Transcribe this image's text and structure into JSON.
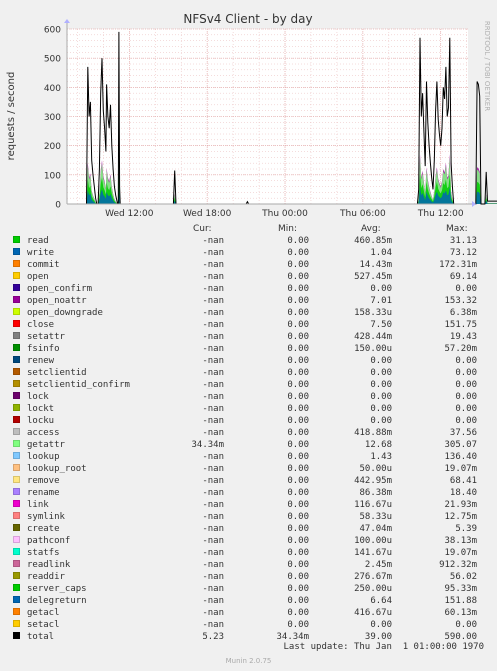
{
  "chart_data": {
    "type": "area",
    "title": "NFSv4 Client - by day",
    "ylabel": "requests / second",
    "watermark": "RRDTOOL / TOBI OETIKER",
    "ylim": [
      0,
      600
    ],
    "yticks": [
      0,
      100,
      200,
      300,
      400,
      500,
      600
    ],
    "y_tick_labels": [
      "0",
      "100",
      "200",
      "300",
      "400",
      "500",
      "600"
    ],
    "x_tick_labels": [
      "Wed 12:00",
      "Wed 18:00",
      "Thu 00:00",
      "Thu 06:00",
      "Thu 12:00"
    ],
    "x_tick_hours": [
      12,
      18,
      24,
      30,
      36
    ],
    "x_range_hours": [
      7.2,
      38.1
    ],
    "grid": true,
    "colors": {
      "background": "#f0f0f0",
      "canvas": "#ffffff",
      "grid": "#e8b8b8",
      "axis": "#aaaaaa",
      "total_line": "#000000"
    },
    "total_series": {
      "name": "total",
      "points": [
        [
          8.7,
          0
        ],
        [
          8.8,
          470
        ],
        [
          8.9,
          300
        ],
        [
          9.0,
          350
        ],
        [
          9.1,
          150
        ],
        [
          9.2,
          100
        ],
        [
          9.3,
          60
        ],
        [
          9.4,
          20
        ],
        [
          9.5,
          0
        ],
        [
          9.6,
          0
        ],
        [
          9.7,
          120
        ],
        [
          9.8,
          380
        ],
        [
          9.9,
          500
        ],
        [
          10.0,
          320
        ],
        [
          10.1,
          260
        ],
        [
          10.2,
          180
        ],
        [
          10.25,
          410
        ],
        [
          10.35,
          300
        ],
        [
          10.45,
          260
        ],
        [
          10.55,
          340
        ],
        [
          10.65,
          200
        ],
        [
          10.75,
          120
        ],
        [
          10.85,
          60
        ],
        [
          10.95,
          30
        ],
        [
          11.05,
          10
        ],
        [
          11.1,
          0
        ],
        [
          11.15,
          0
        ],
        [
          11.2,
          590
        ],
        [
          11.25,
          60
        ],
        [
          11.3,
          0
        ],
        [
          15.4,
          0
        ],
        [
          15.5,
          115
        ],
        [
          15.6,
          0
        ],
        [
          21.0,
          0
        ],
        [
          21.1,
          8
        ],
        [
          21.2,
          0
        ],
        [
          34.2,
          0
        ],
        [
          34.3,
          50
        ],
        [
          34.4,
          570
        ],
        [
          34.5,
          300
        ],
        [
          34.6,
          380
        ],
        [
          34.7,
          250
        ],
        [
          34.8,
          130
        ],
        [
          34.9,
          420
        ],
        [
          35.0,
          280
        ],
        [
          35.1,
          200
        ],
        [
          35.2,
          140
        ],
        [
          35.3,
          90
        ],
        [
          35.4,
          50
        ],
        [
          35.5,
          150
        ],
        [
          35.6,
          320
        ],
        [
          35.7,
          420
        ],
        [
          35.8,
          290
        ],
        [
          35.9,
          240
        ],
        [
          36.0,
          200
        ],
        [
          36.1,
          260
        ],
        [
          36.2,
          400
        ],
        [
          36.3,
          360
        ],
        [
          36.4,
          470
        ],
        [
          36.5,
          300
        ],
        [
          36.6,
          330
        ],
        [
          36.7,
          570
        ],
        [
          36.8,
          140
        ],
        [
          36.9,
          60
        ],
        [
          37.0,
          0
        ],
        [
          38.7,
          0
        ],
        [
          38.8,
          420
        ],
        [
          38.9,
          410
        ],
        [
          39.0,
          370
        ],
        [
          39.1,
          0
        ],
        [
          39.4,
          0
        ],
        [
          39.5,
          110
        ],
        [
          39.6,
          10
        ],
        [
          40.5,
          10
        ]
      ]
    },
    "stack_fraction": 0.3,
    "legend_header": {
      "cur": "Cur:",
      "min": "Min:",
      "avg": "Avg:",
      "max": "Max:"
    },
    "legend": [
      {
        "name": "read",
        "color": "#00cc00",
        "cur": "-nan",
        "min": "0.00",
        "avg": "460.85m",
        "max": "31.13"
      },
      {
        "name": "write",
        "color": "#0066b3",
        "cur": "-nan",
        "min": "0.00",
        "avg": "1.04",
        "max": "73.12"
      },
      {
        "name": "commit",
        "color": "#ff8000",
        "cur": "-nan",
        "min": "0.00",
        "avg": "14.43m",
        "max": "172.31m"
      },
      {
        "name": "open",
        "color": "#ffcc00",
        "cur": "-nan",
        "min": "0.00",
        "avg": "527.45m",
        "max": "69.14"
      },
      {
        "name": "open_confirm",
        "color": "#330099",
        "cur": "-nan",
        "min": "0.00",
        "avg": "0.00",
        "max": "0.00"
      },
      {
        "name": "open_noattr",
        "color": "#990099",
        "cur": "-nan",
        "min": "0.00",
        "avg": "7.01",
        "max": "153.32"
      },
      {
        "name": "open_downgrade",
        "color": "#ccff00",
        "cur": "-nan",
        "min": "0.00",
        "avg": "158.33u",
        "max": "6.38m"
      },
      {
        "name": "close",
        "color": "#ff0000",
        "cur": "-nan",
        "min": "0.00",
        "avg": "7.50",
        "max": "151.75"
      },
      {
        "name": "setattr",
        "color": "#808080",
        "cur": "-nan",
        "min": "0.00",
        "avg": "428.44m",
        "max": "19.43"
      },
      {
        "name": "fsinfo",
        "color": "#008f00",
        "cur": "-nan",
        "min": "0.00",
        "avg": "150.00u",
        "max": "57.20m"
      },
      {
        "name": "renew",
        "color": "#00487d",
        "cur": "-nan",
        "min": "0.00",
        "avg": "0.00",
        "max": "0.00"
      },
      {
        "name": "setclientid",
        "color": "#b35a00",
        "cur": "-nan",
        "min": "0.00",
        "avg": "0.00",
        "max": "0.00"
      },
      {
        "name": "setclientid_confirm",
        "color": "#b38f00",
        "cur": "-nan",
        "min": "0.00",
        "avg": "0.00",
        "max": "0.00"
      },
      {
        "name": "lock",
        "color": "#6b006b",
        "cur": "-nan",
        "min": "0.00",
        "avg": "0.00",
        "max": "0.00"
      },
      {
        "name": "lockt",
        "color": "#8fb300",
        "cur": "-nan",
        "min": "0.00",
        "avg": "0.00",
        "max": "0.00"
      },
      {
        "name": "locku",
        "color": "#b30000",
        "cur": "-nan",
        "min": "0.00",
        "avg": "0.00",
        "max": "0.00"
      },
      {
        "name": "access",
        "color": "#bebebe",
        "cur": "-nan",
        "min": "0.00",
        "avg": "418.88m",
        "max": "37.56"
      },
      {
        "name": "getattr",
        "color": "#80ff80",
        "cur": "34.34m",
        "min": "0.00",
        "avg": "12.68",
        "max": "305.07"
      },
      {
        "name": "lookup",
        "color": "#80c9ff",
        "cur": "-nan",
        "min": "0.00",
        "avg": "1.43",
        "max": "136.40"
      },
      {
        "name": "lookup_root",
        "color": "#ffc080",
        "cur": "-nan",
        "min": "0.00",
        "avg": "50.00u",
        "max": "19.07m"
      },
      {
        "name": "remove",
        "color": "#ffe680",
        "cur": "-nan",
        "min": "0.00",
        "avg": "442.95m",
        "max": "68.41"
      },
      {
        "name": "rename",
        "color": "#aa80ff",
        "cur": "-nan",
        "min": "0.00",
        "avg": "86.38m",
        "max": "18.40"
      },
      {
        "name": "link",
        "color": "#ee00cc",
        "cur": "-nan",
        "min": "0.00",
        "avg": "116.67u",
        "max": "21.93m"
      },
      {
        "name": "symlink",
        "color": "#ff8080",
        "cur": "-nan",
        "min": "0.00",
        "avg": "58.33u",
        "max": "12.75m"
      },
      {
        "name": "create",
        "color": "#666600",
        "cur": "-nan",
        "min": "0.00",
        "avg": "47.04m",
        "max": "5.39"
      },
      {
        "name": "pathconf",
        "color": "#ffbfff",
        "cur": "-nan",
        "min": "0.00",
        "avg": "100.00u",
        "max": "38.13m"
      },
      {
        "name": "statfs",
        "color": "#00ffcc",
        "cur": "-nan",
        "min": "0.00",
        "avg": "141.67u",
        "max": "19.07m"
      },
      {
        "name": "readlink",
        "color": "#cc6699",
        "cur": "-nan",
        "min": "0.00",
        "avg": "2.45m",
        "max": "912.32m"
      },
      {
        "name": "readdir",
        "color": "#999900",
        "cur": "-nan",
        "min": "0.00",
        "avg": "276.67m",
        "max": "56.02"
      },
      {
        "name": "server_caps",
        "color": "#00cc00",
        "cur": "-nan",
        "min": "0.00",
        "avg": "250.00u",
        "max": "95.33m"
      },
      {
        "name": "delegreturn",
        "color": "#0066b3",
        "cur": "-nan",
        "min": "0.00",
        "avg": "6.64",
        "max": "151.88"
      },
      {
        "name": "getacl",
        "color": "#ff8000",
        "cur": "-nan",
        "min": "0.00",
        "avg": "416.67u",
        "max": "60.13m"
      },
      {
        "name": "setacl",
        "color": "#ffcc00",
        "cur": "-nan",
        "min": "0.00",
        "avg": "0.00",
        "max": "0.00"
      },
      {
        "name": "total",
        "color": "#000000",
        "cur": "5.23",
        "min": "34.34m",
        "avg": "39.00",
        "max": "590.00"
      }
    ]
  },
  "footer": {
    "last_update": "Last update: Thu Jan  1 01:00:00 1970",
    "generator": "Munin 2.0.75"
  }
}
